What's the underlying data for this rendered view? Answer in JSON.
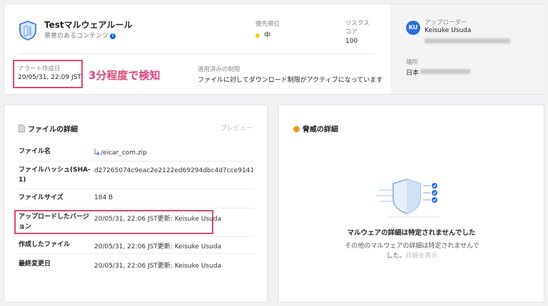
{
  "policy": {
    "title": "Testマルウェアルール",
    "subtitle": "悪意のあるコンテンツ"
  },
  "priority": {
    "label": "優先順位",
    "value": "中"
  },
  "risk": {
    "label_line1": "リスクス",
    "label_line2": "コア",
    "value": "100"
  },
  "alert": {
    "label": "アラート作成日",
    "value": "20/05/31, 22:09 JST"
  },
  "annotation": "3分程度で検知",
  "restriction": {
    "label": "適用済みの制限",
    "value": "ファイルに対してダウンロード制限がアクティブになっています"
  },
  "uploader": {
    "label": "アップローダー",
    "initials": "KU",
    "name": "Keisuke Usuda"
  },
  "location": {
    "label": "場所",
    "value": "日本"
  },
  "file_details": {
    "title": "ファイルの詳細",
    "preview": "プレビュー",
    "rows": [
      {
        "label": "ファイル名",
        "value": "/eicar_com.zip"
      },
      {
        "label_line1": "ファイルハッシュ(SHA-",
        "label_line2": "1)",
        "value": "d27265074c9eac2e2122ed69294dbc4d7cce9141"
      },
      {
        "label": "ファイルサイズ",
        "value": "184 B"
      },
      {
        "label_line1": "アップロードしたバージ",
        "label_line2": "ョン",
        "value": "20/05/31, 22:06 JST更新: Keisuke Usuda"
      },
      {
        "label": "作成したファイル",
        "value": "20/05/31, 22:06 JST更新: Keisuke Usuda"
      },
      {
        "label": "最終変更日",
        "value": "20/05/31, 22:06 JST更新: Keisuke Usuda"
      }
    ]
  },
  "threat": {
    "title": "脅威の詳細",
    "heading": "マルウェアの詳細は特定されませんでした",
    "desc_line1": "その他のマルウェアの詳細は特定されませんで",
    "desc_line2": "した。",
    "link": "詳細を表示"
  },
  "colors": {
    "accent": "#0061d5",
    "highlight": "#e0457b",
    "priority_dot": "#f6c51c",
    "threat_dot": "#f09b1c"
  }
}
